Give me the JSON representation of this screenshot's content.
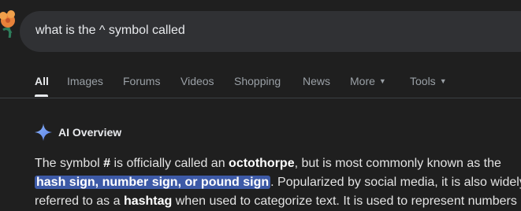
{
  "search": {
    "query": "what is the ^ symbol called"
  },
  "tabs": [
    {
      "label": "All",
      "active": true
    },
    {
      "label": "Images"
    },
    {
      "label": "Forums"
    },
    {
      "label": "Videos"
    },
    {
      "label": "Shopping"
    },
    {
      "label": "News"
    },
    {
      "label": "More",
      "has_dropdown": true
    },
    {
      "label": "Tools",
      "has_dropdown": true
    }
  ],
  "ai_overview": {
    "title": "AI Overview",
    "icon": "sparkle-icon",
    "line1": {
      "t1": "The symbol ",
      "b1": "#",
      "t2": " is officially called an ",
      "b2": "octothorpe",
      "t3": ", but is most commonly known as the"
    },
    "line2": {
      "highlight": "hash sign, number sign, or pound sign",
      "t1": ". Popularized by social media, it is also widely"
    },
    "line3": {
      "t1": "referred to as a ",
      "b1": "hashtag",
      "t2": " when used to categorize text. It is used to represent numbers"
    }
  },
  "colors": {
    "background": "#1f1f1f",
    "searchbox": "#303134",
    "highlight": "#3d5aa7",
    "sparkle": "#7ea2f5"
  }
}
